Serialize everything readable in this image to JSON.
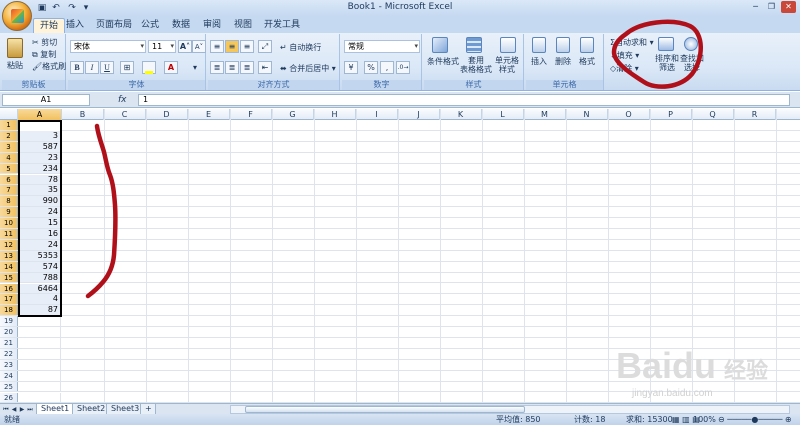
{
  "window": {
    "title": "Book1 - Microsoft Excel",
    "qat": [
      "save-icon",
      "undo-icon",
      "redo-icon"
    ],
    "controls": [
      "minimize",
      "restore",
      "close"
    ]
  },
  "tabs": [
    {
      "label": "开始",
      "active": true
    },
    {
      "label": "插入"
    },
    {
      "label": "页面布局"
    },
    {
      "label": "公式"
    },
    {
      "label": "数据"
    },
    {
      "label": "审阅"
    },
    {
      "label": "视图"
    },
    {
      "label": "开发工具"
    }
  ],
  "ribbon": {
    "clipboard": {
      "label": "剪贴板",
      "paste": "粘贴",
      "cut": "剪切",
      "copy": "复制",
      "format_painter": "格式刷"
    },
    "font": {
      "label": "字体",
      "font_name": "宋体",
      "font_size": "11",
      "bold": "B",
      "italic": "I",
      "underline": "U"
    },
    "alignment": {
      "label": "对齐方式",
      "wrap": "自动换行",
      "merge": "合并后居中"
    },
    "number": {
      "label": "数字",
      "format": "常规",
      "percent": "%",
      "comma": ","
    },
    "styles": {
      "label": "样式",
      "conditional": "条件格式",
      "table": "套用\n表格格式",
      "cell": "单元格\n样式"
    },
    "cells": {
      "label": "单元格",
      "insert": "插入",
      "delete": "删除",
      "format": "格式"
    },
    "editing": {
      "autosum": "自动求和",
      "fill": "填充",
      "clear": "清除",
      "sort": "排序和\n筛选",
      "find": "查找和\n选择"
    }
  },
  "formula_bar": {
    "name_box": "A1",
    "fx": "fx",
    "content": "1"
  },
  "columns": [
    "A",
    "B",
    "C",
    "D",
    "E",
    "F",
    "G",
    "H",
    "I",
    "J",
    "K",
    "L",
    "M",
    "N",
    "O",
    "P",
    "Q",
    "R"
  ],
  "rows": [
    "1",
    "2",
    "3",
    "4",
    "5",
    "6",
    "7",
    "8",
    "9",
    "10",
    "11",
    "12",
    "13",
    "14",
    "15",
    "16",
    "17",
    "18",
    "19",
    "20",
    "21",
    "22",
    "23",
    "24",
    "25",
    "26",
    "27"
  ],
  "cells_A": [
    "1",
    "3",
    "587",
    "23",
    "234",
    "78",
    "35",
    "990",
    "24",
    "15",
    "16",
    "24",
    "5353",
    "574",
    "788",
    "6464",
    "4",
    "87"
  ],
  "sheets": [
    "Sheet1",
    "Sheet2",
    "Sheet3"
  ],
  "status": {
    "ready": "就绪",
    "average": "平均值: 850",
    "count": "计数: 18",
    "sum": "求和: 15300",
    "zoom": "100%"
  },
  "watermark": {
    "brand": "Baidu",
    "brand_cn": "经验",
    "url": "jingyan.baidu.com"
  },
  "colors": {
    "annotation": "#b0101a",
    "selection_header": "#f1c15f",
    "ribbon_bg": "#dbe8f7"
  }
}
